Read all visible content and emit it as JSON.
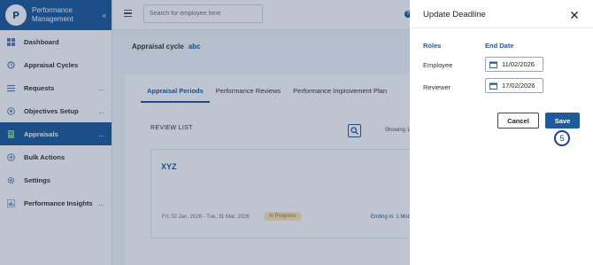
{
  "app": {
    "brand_line1": "Performance",
    "brand_line2": "Management",
    "logo_letter": "P"
  },
  "sidebar": {
    "items": [
      {
        "label": "Dashboard",
        "icon": "dashboard-icon",
        "more": ""
      },
      {
        "label": "Appraisal Cycles",
        "icon": "cycle-icon",
        "more": ""
      },
      {
        "label": "Requests",
        "icon": "list-icon",
        "more": "..."
      },
      {
        "label": "Objectives Setup",
        "icon": "target-icon",
        "more": "..."
      },
      {
        "label": "Appraisals",
        "icon": "document-icon",
        "more": "...",
        "active": true
      },
      {
        "label": "Bulk Actions",
        "icon": "bulk-icon",
        "more": ""
      },
      {
        "label": "Settings",
        "icon": "gear-icon",
        "more": ""
      },
      {
        "label": "Performance Insights",
        "icon": "insights-icon",
        "more": "..."
      }
    ]
  },
  "topbar": {
    "search_placeholder": "Search for employee here",
    "help_icon": "?"
  },
  "cycle": {
    "label": "Appraisal cycle",
    "value": "abc"
  },
  "tabs": [
    {
      "label": "Appraisal Periods",
      "active": true
    },
    {
      "label": "Performance Reviews",
      "active": false
    },
    {
      "label": "Performance Improvement Plan",
      "active": false
    }
  ],
  "review_list": {
    "heading": "REVIEW LIST",
    "showing": "Showing 1",
    "card": {
      "title": "XYZ",
      "dates": "Fri, 02 Jan, 2026 - Tue, 31 Mar, 2026",
      "status": "In Progress",
      "ending": "Ending in: 1 Mon"
    }
  },
  "drawer": {
    "title": "Update Deadline",
    "col_roles": "Roles",
    "col_end_date": "End Date",
    "rows": [
      {
        "role": "Employee",
        "date": "11/02/2026"
      },
      {
        "role": "Reviewer",
        "date": "17/02/2026"
      }
    ],
    "cancel_label": "Cancel",
    "save_label": "Save",
    "step_number": "5"
  },
  "colors": {
    "primary": "#1f5a9a",
    "overlay": "rgba(20,48,90,0.28)",
    "status_bg": "#fde8b9"
  }
}
